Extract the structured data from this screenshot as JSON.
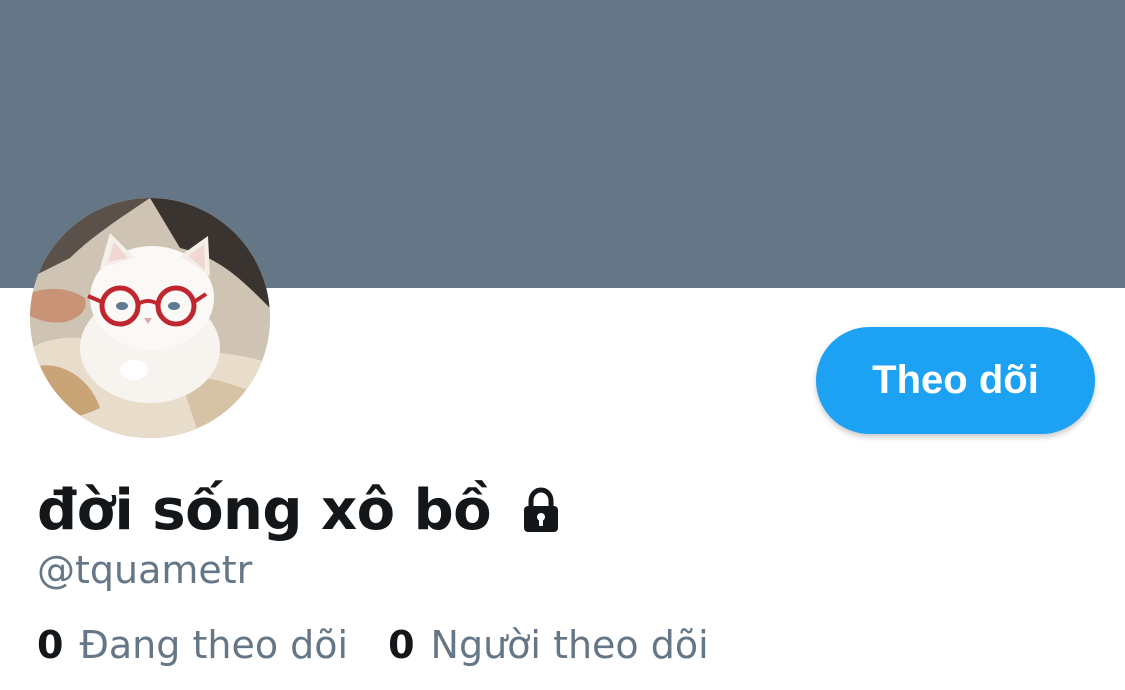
{
  "colors": {
    "banner": "#657786",
    "accent": "#1da1f2",
    "text_primary": "#14171a",
    "text_secondary": "#657786"
  },
  "profile": {
    "display_name": "đời sống xô bồ",
    "handle": "@tquametr",
    "protected_icon": "lock-icon",
    "avatar_description": "white kitten wearing red glasses"
  },
  "actions": {
    "follow_label": "Theo dõi"
  },
  "stats": {
    "following": {
      "count": "0",
      "label": "Đang theo dõi"
    },
    "followers": {
      "count": "0",
      "label": "Người theo dõi"
    }
  }
}
